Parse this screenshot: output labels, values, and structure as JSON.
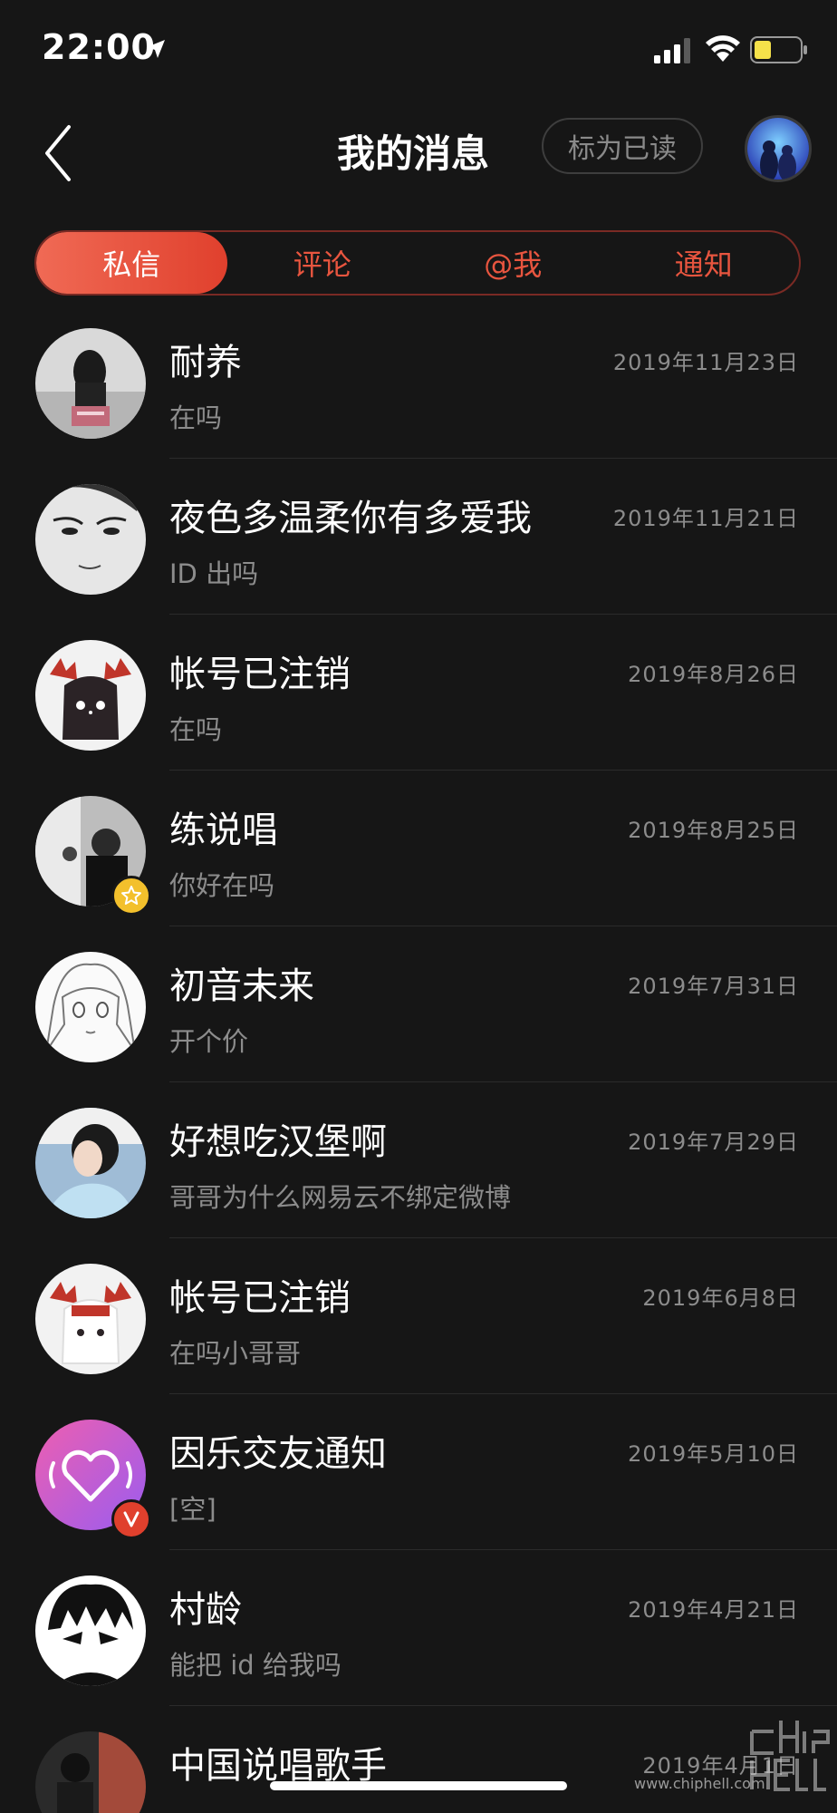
{
  "status_bar": {
    "time": "22:00"
  },
  "header": {
    "title": "我的消息",
    "mark_read": "标为已读"
  },
  "tabs": [
    {
      "label": "私信"
    },
    {
      "label": "评论"
    },
    {
      "label": "@我"
    },
    {
      "label": "通知"
    }
  ],
  "messages": [
    {
      "name": "耐养",
      "preview": "在吗",
      "date": "2019年11月23日"
    },
    {
      "name": "夜色多温柔你有多爱我",
      "preview": "ID 出吗",
      "date": "2019年11月21日"
    },
    {
      "name": "帐号已注销",
      "preview": "在吗",
      "date": "2019年8月26日"
    },
    {
      "name": "练说唱",
      "preview": "你好在吗",
      "date": "2019年8月25日"
    },
    {
      "name": "初音未来",
      "preview": "开个价",
      "date": "2019年7月31日"
    },
    {
      "name": "好想吃汉堡啊",
      "preview": "哥哥为什么网易云不绑定微博",
      "date": "2019年7月29日"
    },
    {
      "name": "帐号已注销",
      "preview": " 在吗小哥哥",
      "date": "2019年6月8日"
    },
    {
      "name": "因乐交友通知",
      "preview": "[空]",
      "date": "2019年5月10日"
    },
    {
      "name": "村龄",
      "preview": "能把 id 给我吗",
      "date": "2019年4月21日"
    },
    {
      "name": "中国说唱歌手",
      "preview": "",
      "date": "2019年4月1日"
    }
  ],
  "watermark": "www.chiphell.com",
  "colors": {
    "accent": "#e8553f",
    "background": "#161616",
    "secondary_text": "#8c8c8c"
  }
}
